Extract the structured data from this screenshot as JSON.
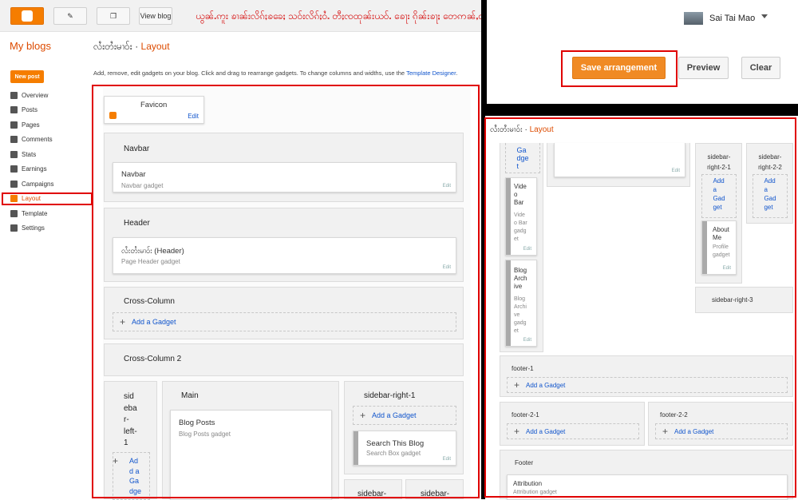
{
  "topbar": {
    "view_blog": "View blog",
    "announcement": "ယွၼ်ႉဢူး ၶၢၼ်းလိၵ်ႈၶခေႈ သဝ်းလိၵ်ႈဝႆႉ တီႈၸထုၼ်းယဝ်ႉ ၶေႃး ၵိုၼ်းၶႃႈ တေဢၼ်ႇတီႈၸၢၼ်းလိၵ်ႈသၢင်းတွၵ်ႈ ထိၼ်ႈယဝ်ႉ",
    "user_name": "Sai Tai Mao"
  },
  "sidebar": {
    "my_blogs": "My blogs",
    "new_post": "New post",
    "items": [
      {
        "label": "Overview",
        "icon": "home-icon"
      },
      {
        "label": "Posts",
        "icon": "posts-icon"
      },
      {
        "label": "Pages",
        "icon": "pages-icon"
      },
      {
        "label": "Comments",
        "icon": "comments-icon"
      },
      {
        "label": "Stats",
        "icon": "stats-icon"
      },
      {
        "label": "Earnings",
        "icon": "trophy-icon"
      },
      {
        "label": "Campaigns",
        "icon": "campaigns-icon"
      },
      {
        "label": "Layout",
        "icon": "layout-icon"
      },
      {
        "label": "Template",
        "icon": "template-icon"
      },
      {
        "label": "Settings",
        "icon": "wrench-icon"
      }
    ]
  },
  "header": {
    "blog_name": "လႆးတႆးမၢဝ်း",
    "separator": "·",
    "page": "Layout",
    "description": "Add, remove, edit gadgets on your blog. Click and drag to rearrange gadgets. To change columns and widths, use the ",
    "template_designer": "Template Designer",
    "period": "."
  },
  "layout": {
    "favicon": {
      "title": "Favicon",
      "edit": "Edit"
    },
    "navbar": {
      "title": "Navbar",
      "gadget": "Navbar",
      "sub": "Navbar gadget",
      "edit": "Edit"
    },
    "headerp": {
      "title": "Header",
      "gadget": "လႆးတႆးမၢဝ်း (Header)",
      "sub": "Page Header gadget",
      "edit": "Edit"
    },
    "cross1": {
      "title": "Cross-Column",
      "add": "Add a Gadget"
    },
    "cross2": {
      "title": "Cross-Column 2"
    },
    "left1": {
      "title": "sid\neba\nr-\nleft-\n1",
      "add": "Ad\nd a\nGa\ndge"
    },
    "main": {
      "title": "Main",
      "gadget": "Blog Posts",
      "sub": "Blog Posts gadget"
    },
    "right1": {
      "title": "sidebar-right-1",
      "add": "Add a Gadget",
      "gadget": "Search This Blog",
      "sub": "Search Box gadget",
      "edit": "Edit"
    },
    "right_bottom_a": "sidebar-",
    "right_bottom_b": "sidebar-"
  },
  "actions": {
    "save": "Save arrangement",
    "preview": "Preview",
    "clear": "Clear"
  },
  "right_view": {
    "blog_name": "လႆးတႆးမၢဝ်း",
    "separator": "·",
    "page": "Layout",
    "col_gadget_top": "Ga\ndge\nt",
    "video_bar": "Vide\no\nBar",
    "video_sub": "Vide\no Bar\ngadg\net",
    "archive": "Blog\nArch\nive",
    "archive_sub": "Blog\nArchi\nve\ngadg\net",
    "edit": "Edit",
    "r21_title": "sidebar-\nright-2-1",
    "r22_title": "sidebar-\nright-2-2",
    "add_short": "Add\na\nGad\nget",
    "about_me": "About\nMe",
    "about_sub": "Profile\ngadget",
    "r3_title": "sidebar-right-3",
    "footer1": "footer-1",
    "footer21": "footer-2-1",
    "footer22": "footer-2-2",
    "footer": "Footer",
    "add": "Add a Gadget",
    "attribution": "Attribution",
    "attribution_sub": "Attribution gadget"
  }
}
